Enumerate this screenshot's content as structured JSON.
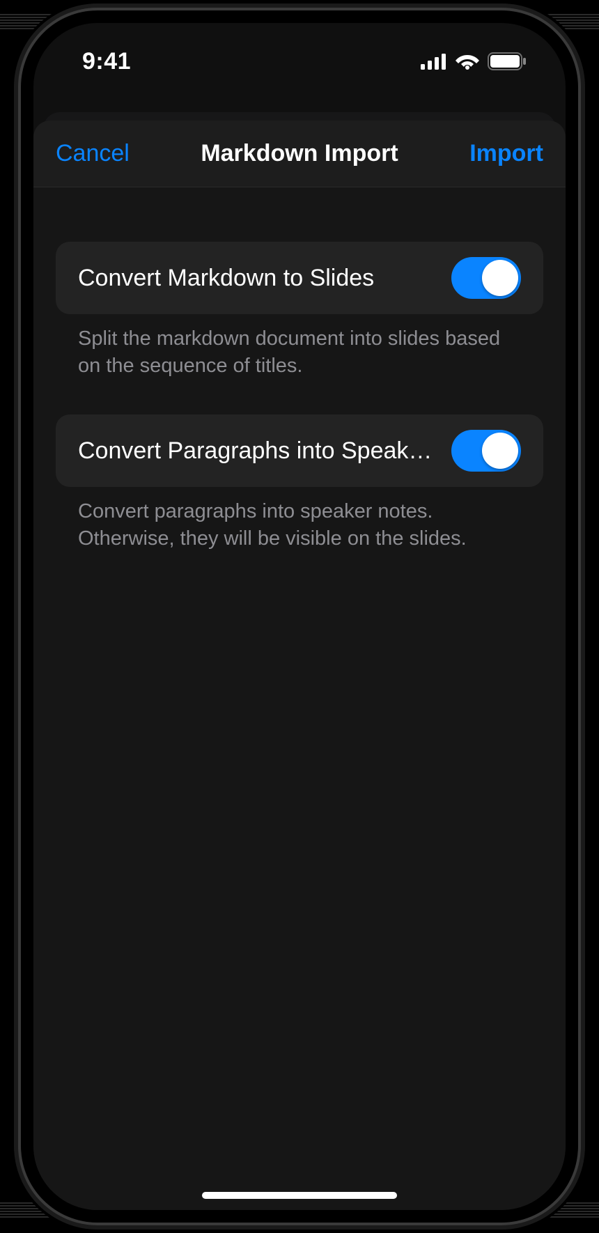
{
  "status": {
    "time": "9:41"
  },
  "nav": {
    "cancel": "Cancel",
    "title": "Markdown Import",
    "import": "Import"
  },
  "sections": [
    {
      "label": "Convert Markdown to Slides",
      "toggle_on": true,
      "footer": "Split the markdown document into slides based on the sequence of titles."
    },
    {
      "label": "Convert Paragraphs into Speaker Notes",
      "toggle_on": true,
      "footer": "Convert paragraphs into speaker notes. Otherwise, they will be visible on the slides."
    }
  ],
  "colors": {
    "accent": "#0a84ff",
    "background": "#161616",
    "row": "#232323",
    "text_secondary": "#8e8e93"
  }
}
